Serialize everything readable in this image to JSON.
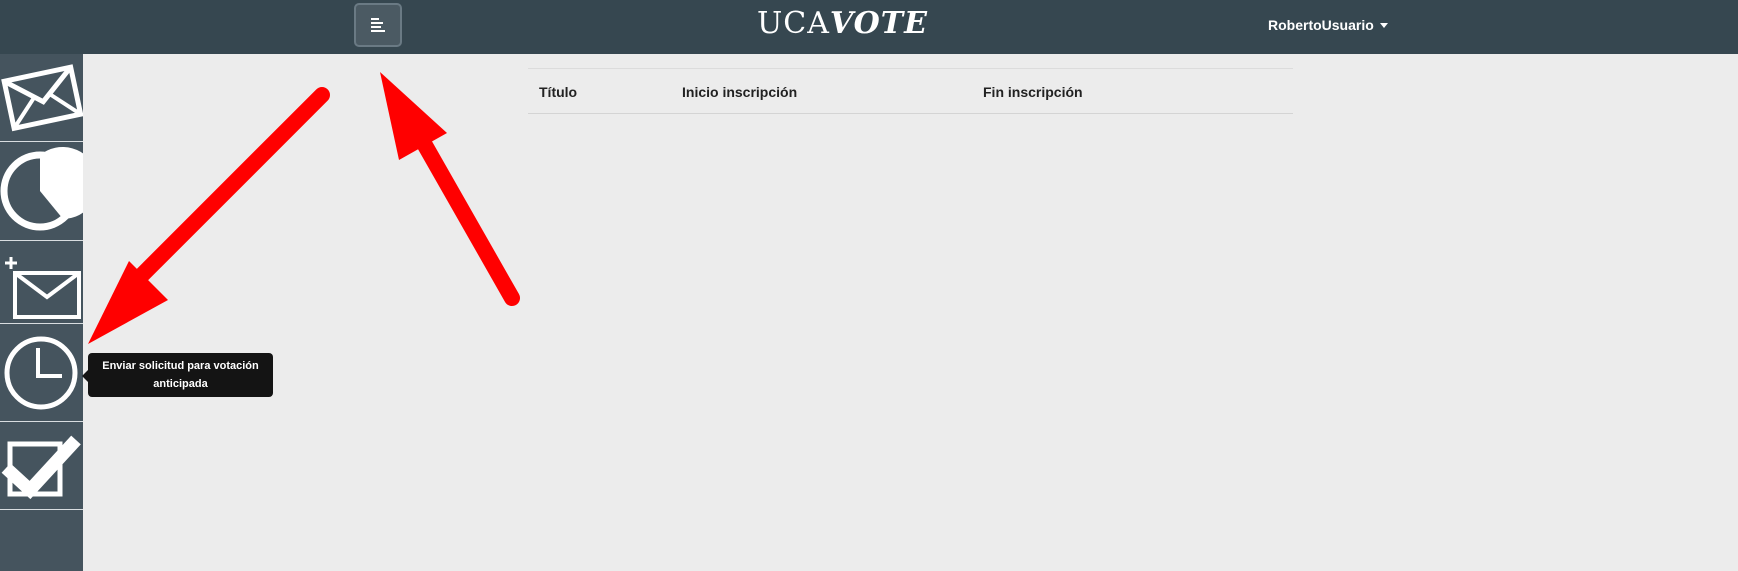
{
  "navbar": {
    "brand_part1": "UCA",
    "brand_part2": "VOTE",
    "user_name": "RobertoUsuario",
    "background": "#364750"
  },
  "sidebar": {
    "background": "#45545e",
    "items": [
      {
        "icon": "envelope-icon"
      },
      {
        "icon": "pie-chart-icon"
      },
      {
        "icon": "new-message-icon"
      },
      {
        "icon": "clock-icon"
      },
      {
        "icon": "checkbox-icon"
      }
    ]
  },
  "table": {
    "columns": [
      "Título",
      "Inicio inscripción",
      "Fin inscripción"
    ]
  },
  "tooltip": {
    "text": "Enviar solicitud para votación anticipada"
  },
  "annotation_color": "#ff0000"
}
